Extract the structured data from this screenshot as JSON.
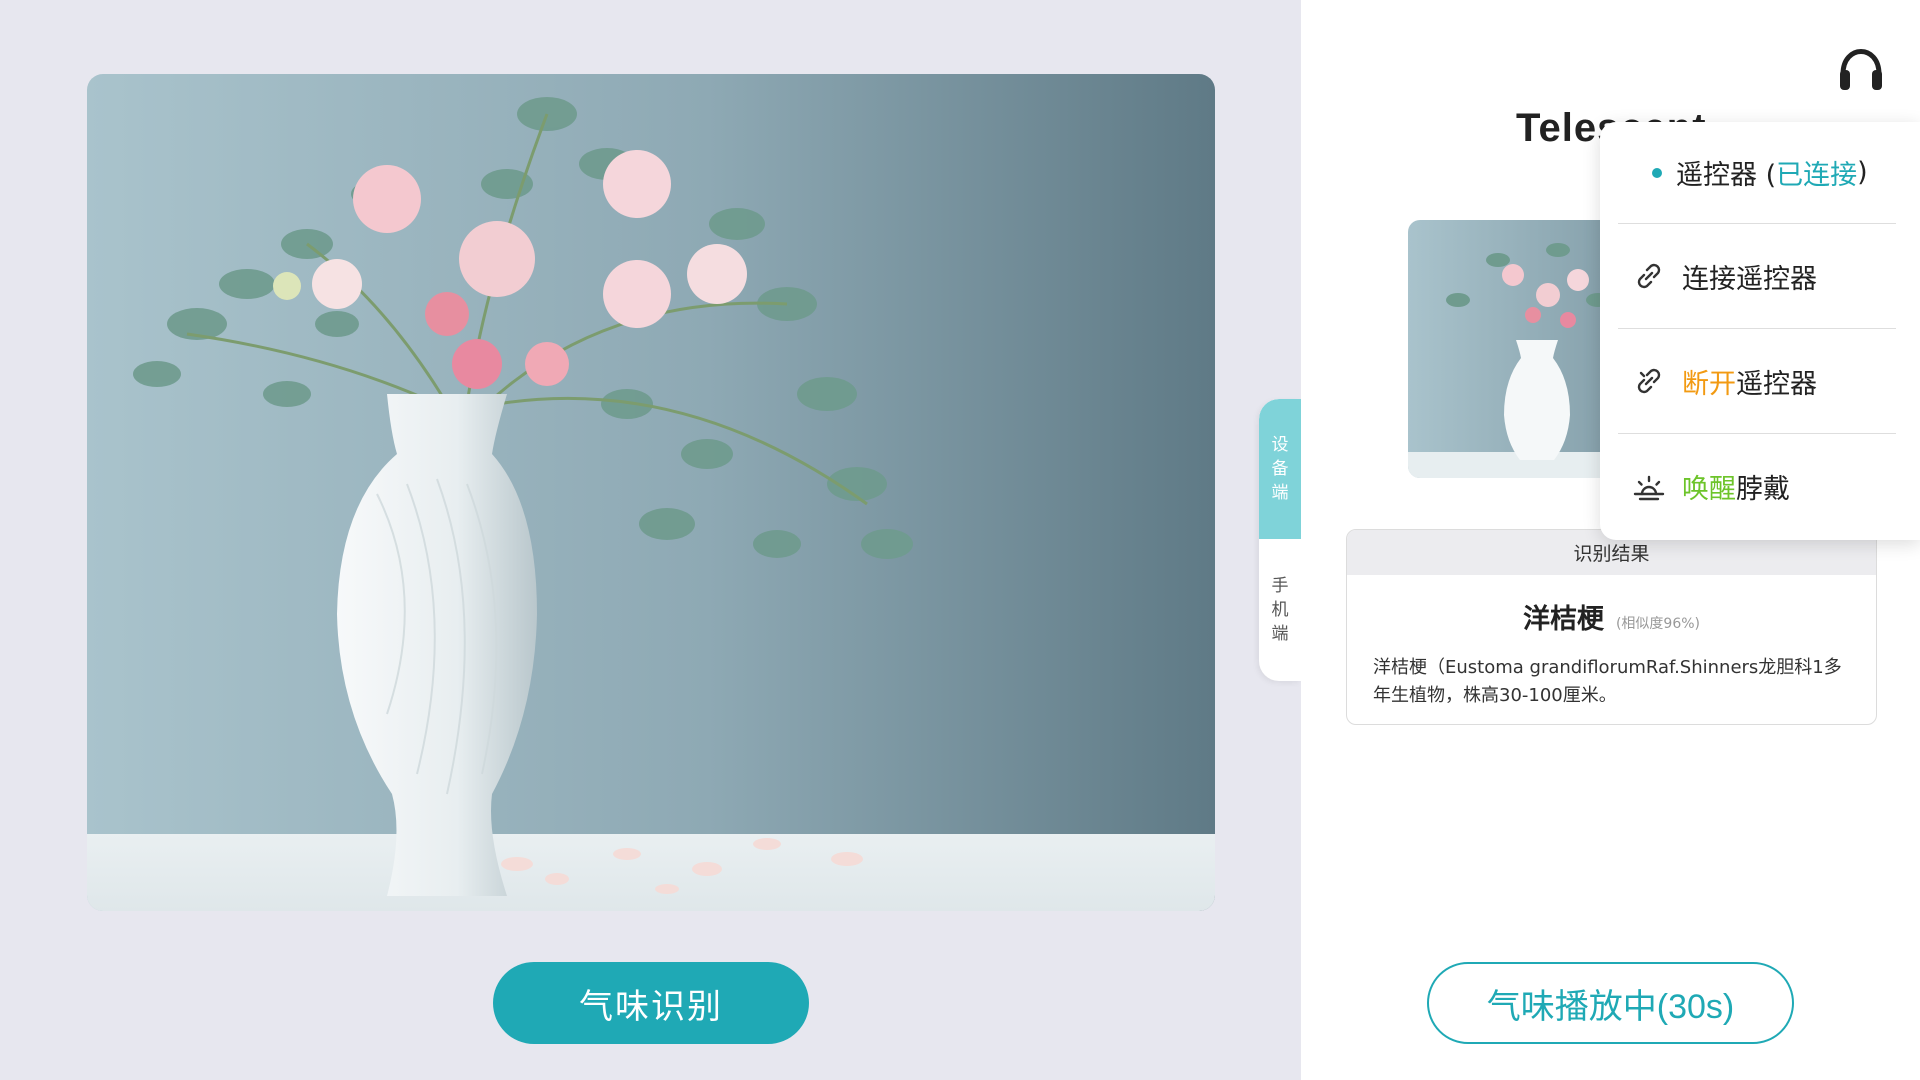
{
  "left": {
    "photo": {
      "alt": "white vase with pink flowers and eucalyptus"
    },
    "identify_button": "气味识别"
  },
  "tabs": [
    {
      "label": [
        "设",
        "备",
        "端"
      ],
      "active": true
    },
    {
      "label": [
        "手",
        "机",
        "端"
      ],
      "active": false
    }
  ],
  "right": {
    "title": "Telescent",
    "headphone_icon": "headphone-icon",
    "result": {
      "header": "识别结果",
      "name": "洋桔梗",
      "similarity": "(相似度96%)",
      "description": "洋桔梗（Eustoma grandiflorumRaf.Shinners龙胆科1多年生植物，株高30-100厘米。"
    },
    "play_button": "气味播放中(30s)"
  },
  "menu": {
    "status": {
      "prefix": "遥控器 (",
      "state": "已连接",
      "suffix": ")"
    },
    "connect": {
      "label": "连接遥控器",
      "icon": "link-icon"
    },
    "disconnect": {
      "action": "断开",
      "label": "遥控器",
      "icon": "unlink-icon"
    },
    "wake": {
      "action": "唤醒",
      "label": "脖戴",
      "icon": "sunrise-icon"
    }
  },
  "colors": {
    "accent": "#1fa9b5",
    "tab_active": "#7fd3d9",
    "disconnect": "#f29a12",
    "wake": "#6dc42a",
    "background": "#e7e7ef"
  }
}
